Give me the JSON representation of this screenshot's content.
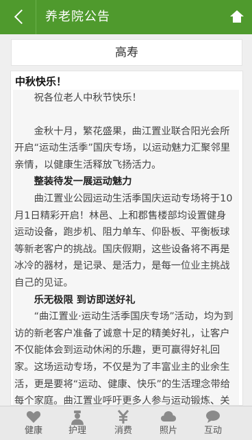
{
  "header": {
    "title": "养老院公告"
  },
  "resident_name": "高寿",
  "article": {
    "title": "中秋快乐！",
    "paragraphs": [
      {
        "text": "祝各位老人中秋节快乐！",
        "style": "normal"
      },
      {
        "text": "金秋十月，繁花盛果，曲江置业联合阳光会所开启“运动生活季”国庆专场，以运动魅力汇聚邻里亲情，以健康生活释放飞扬活力。",
        "style": "spaced"
      },
      {
        "text": "整装待发一展运动魅力",
        "style": "sub"
      },
      {
        "text": "曲江置业公园运动生活季国庆运动专场将于10月1日精彩开启！林邑、上和郡售楼部均设置健身运动设备，跑步机、阻力单车、仰卧板、平衡板球等新老客户的挑战。国庆假期，这些设备将不再是冰冷的器材，是记录、是活力，是每一位业主挑战自己的见证。",
        "style": "normal"
      },
      {
        "text": "乐无极限 到访即送好礼",
        "style": "sub"
      },
      {
        "text": "“曲江置业·运动生活季国庆专场”活动，均为到访的新老客户准备了诚意十足的精美好礼，让客户不仅能体会到运动休闲的乐趣，更可赢得好礼回家。这场运动专场，不仅是为了丰富业主的业余生活，更是要将“运动、健康、快乐”的生活理念带给每个家庭。曲江置业呼吁更多人参与运动锻炼、关注自身健康，",
        "style": "normal"
      }
    ]
  },
  "bottom_nav": {
    "items": [
      {
        "label": "健康",
        "icon": "heart-icon"
      },
      {
        "label": "护理",
        "icon": "nurse-icon"
      },
      {
        "label": "消费",
        "icon": "yen-icon"
      },
      {
        "label": "照片",
        "icon": "cloud-icon"
      },
      {
        "label": "互动",
        "icon": "chat-bubble-icon"
      }
    ]
  },
  "colors": {
    "header_green": "#4f9a2d",
    "nav_icon_gray": "#8a8a8a"
  }
}
